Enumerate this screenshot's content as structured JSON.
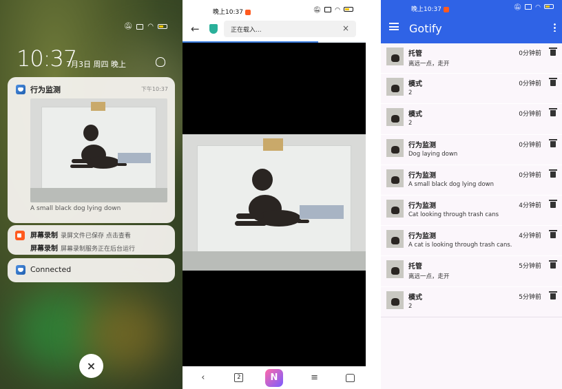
{
  "lockscreen": {
    "clock": "10:37",
    "date": "7月3日 周四 晚上",
    "notification_main": {
      "app": "行为监测",
      "time": "下午10:37",
      "caption": "A small black dog lying down"
    },
    "notification_recorder": {
      "title1": "屏幕录制",
      "text1": "录屏文件已保存 点击查看",
      "title2": "屏幕录制",
      "text2": "屏幕录制服务正在后台运行"
    },
    "notification_connected": {
      "title": "Connected"
    },
    "close_symbol": "×"
  },
  "browser": {
    "status_time": "晚上10:37",
    "back_symbol": "←",
    "url_text": "正在载入...",
    "clear_symbol": "×",
    "progress": 0.74,
    "toolbar": {
      "back": "‹",
      "tabs_count": "2",
      "ai": "N",
      "menu": "≡"
    }
  },
  "gotify": {
    "status_time": "晚上10:37",
    "title": "Gotify",
    "messages": [
      {
        "title": "托管",
        "body": "离远一点，走开",
        "age": "0分钟前"
      },
      {
        "title": "模式",
        "body": "2",
        "age": "0分钟前"
      },
      {
        "title": "模式",
        "body": "2",
        "age": "0分钟前"
      },
      {
        "title": "行为监测",
        "body": "Dog laying down",
        "age": "0分钟前"
      },
      {
        "title": "行为监测",
        "body": "A small black dog lying down",
        "age": "0分钟前"
      },
      {
        "title": "行为监测",
        "body": "Cat looking through trash cans",
        "age": "4分钟前"
      },
      {
        "title": "行为监测",
        "body": "A cat is looking through trash cans.",
        "age": "4分钟前"
      },
      {
        "title": "托管",
        "body": "离远一点，走开",
        "age": "5分钟前"
      },
      {
        "title": "模式",
        "body": "2",
        "age": "5分钟前"
      }
    ]
  }
}
